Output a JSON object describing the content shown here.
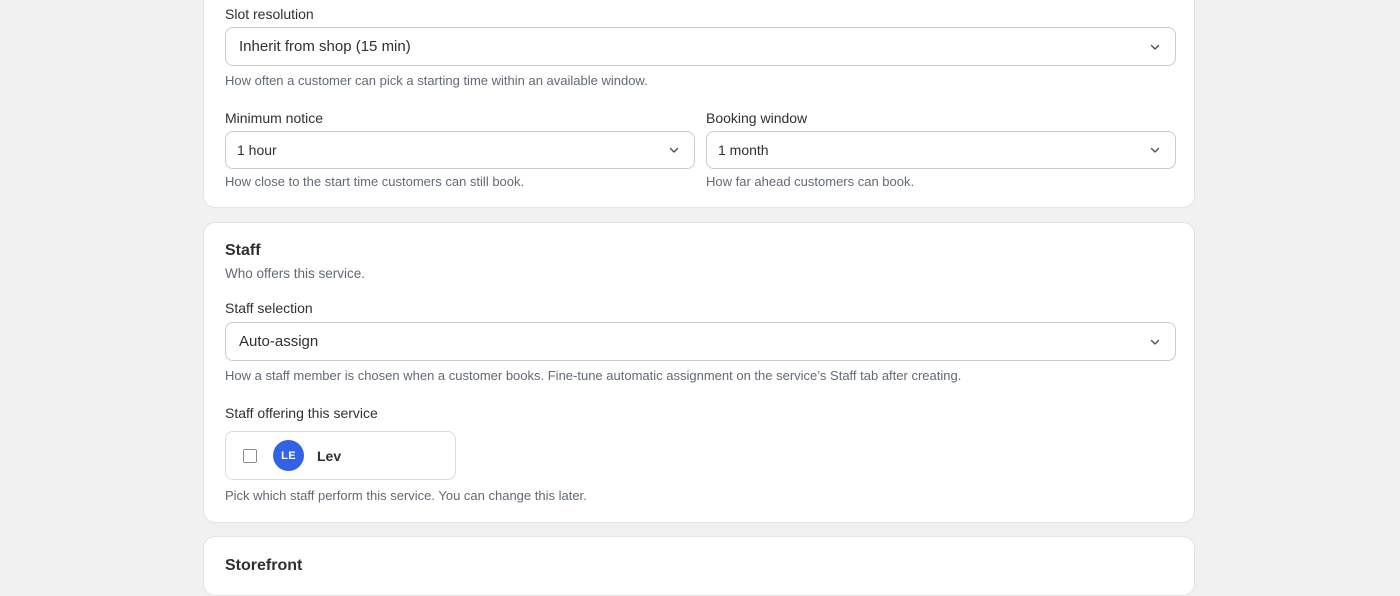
{
  "scheduling": {
    "slot_resolution": {
      "label": "Slot resolution",
      "value": "Inherit from shop (15 min)",
      "help": "How often a customer can pick a starting time within an available window."
    },
    "minimum_notice": {
      "label": "Minimum notice",
      "value": "1 hour",
      "help": "How close to the start time customers can still book."
    },
    "booking_window": {
      "label": "Booking window",
      "value": "1 month",
      "help": "How far ahead customers can book."
    }
  },
  "staff": {
    "title": "Staff",
    "subtitle": "Who offers this service.",
    "selection": {
      "label": "Staff selection",
      "value": "Auto-assign",
      "help": "How a staff member is chosen when a customer books. Fine-tune automatic assignment on the service’s Staff tab after creating."
    },
    "offering": {
      "label": "Staff offering this service",
      "members": [
        {
          "initials": "LE",
          "name": "Lev",
          "checked": false
        }
      ],
      "help": "Pick which staff perform this service. You can change this later."
    }
  },
  "storefront": {
    "title": "Storefront"
  },
  "icons": {
    "select_chevron": "chevron-down-icon"
  },
  "colors": {
    "avatar": "#3263e6",
    "page_bg": "#f1f1f1",
    "card_bg": "#ffffff"
  }
}
